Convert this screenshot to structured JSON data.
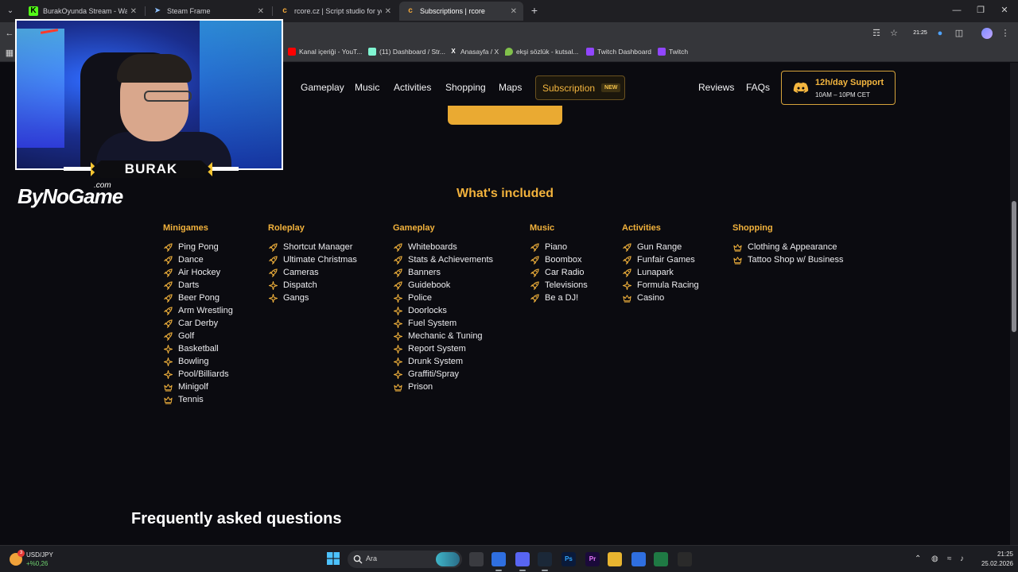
{
  "browser": {
    "tabs": [
      {
        "label": "BurakOyunda Stream - Watch L",
        "favicon": "kick-icon",
        "active": false
      },
      {
        "label": "Steam Frame",
        "favicon": "steam-icon",
        "active": false
      },
      {
        "label": "rcore.cz | Script studio for your",
        "favicon": "rcore-icon",
        "active": false
      },
      {
        "label": "Subscriptions | rcore",
        "favicon": "rcore-icon",
        "active": true
      }
    ],
    "toolbar_clock": "21:25",
    "bookmarks": [
      {
        "label": "Kanal içeriği - YouT...",
        "icon": "youtube-icon",
        "color": "#ff0000"
      },
      {
        "label": "(11) Dashboard / Str...",
        "icon": "streamlabs-icon",
        "color": "#80f5d2"
      },
      {
        "label": "Anasayfa / X",
        "icon": "x-icon",
        "color": "#ffffff"
      },
      {
        "label": "ekşi sözlük - kutsal...",
        "icon": "eksi-icon",
        "color": "#81c14b"
      },
      {
        "label": "Twitch Dashboard",
        "icon": "twitch-icon",
        "color": "#9146ff"
      },
      {
        "label": "Twitch",
        "icon": "twitch-icon",
        "color": "#9146ff"
      }
    ]
  },
  "site": {
    "nav": {
      "gameplay": "Gameplay",
      "music": "Music",
      "activities": "Activities",
      "shopping": "Shopping",
      "maps": "Maps",
      "subscription": "Subscription",
      "subscription_badge": "NEW",
      "reviews": "Reviews",
      "faqs": "FAQs"
    },
    "support": {
      "title": "12h/day Support",
      "hours": "10AM – 10PM CET",
      "icon": "discord-icon"
    },
    "included_title": "What's included",
    "columns": [
      {
        "heading": "Minigames",
        "items": [
          {
            "label": "Ping Pong",
            "icon": "rocket-icon"
          },
          {
            "label": "Dance",
            "icon": "rocket-icon"
          },
          {
            "label": "Air Hockey",
            "icon": "rocket-icon"
          },
          {
            "label": "Darts",
            "icon": "rocket-icon"
          },
          {
            "label": "Beer Pong",
            "icon": "rocket-icon"
          },
          {
            "label": "Arm Wrestling",
            "icon": "rocket-icon"
          },
          {
            "label": "Car Derby",
            "icon": "rocket-icon"
          },
          {
            "label": "Golf",
            "icon": "rocket-icon"
          },
          {
            "label": "Basketball",
            "icon": "sparkle-icon"
          },
          {
            "label": "Bowling",
            "icon": "sparkle-icon"
          },
          {
            "label": "Pool/Billiards",
            "icon": "sparkle-icon"
          },
          {
            "label": "Minigolf",
            "icon": "crown-icon"
          },
          {
            "label": "Tennis",
            "icon": "crown-icon"
          }
        ]
      },
      {
        "heading": "Roleplay",
        "items": [
          {
            "label": "Shortcut Manager",
            "icon": "rocket-icon"
          },
          {
            "label": "Ultimate Christmas",
            "icon": "rocket-icon"
          },
          {
            "label": "Cameras",
            "icon": "rocket-icon"
          },
          {
            "label": "Dispatch",
            "icon": "sparkle-icon"
          },
          {
            "label": "Gangs",
            "icon": "sparkle-icon"
          }
        ]
      },
      {
        "heading": "Gameplay",
        "items": [
          {
            "label": "Whiteboards",
            "icon": "rocket-icon"
          },
          {
            "label": "Stats & Achievements",
            "icon": "rocket-icon"
          },
          {
            "label": "Banners",
            "icon": "rocket-icon"
          },
          {
            "label": "Guidebook",
            "icon": "rocket-icon"
          },
          {
            "label": "Police",
            "icon": "sparkle-icon"
          },
          {
            "label": "Doorlocks",
            "icon": "sparkle-icon"
          },
          {
            "label": "Fuel System",
            "icon": "sparkle-icon"
          },
          {
            "label": "Mechanic & Tuning",
            "icon": "sparkle-icon"
          },
          {
            "label": "Report System",
            "icon": "sparkle-icon"
          },
          {
            "label": "Drunk System",
            "icon": "sparkle-icon"
          },
          {
            "label": "Graffiti/Spray",
            "icon": "sparkle-icon"
          },
          {
            "label": "Prison",
            "icon": "crown-icon"
          }
        ]
      },
      {
        "heading": "Music",
        "items": [
          {
            "label": "Piano",
            "icon": "rocket-icon"
          },
          {
            "label": "Boombox",
            "icon": "rocket-icon"
          },
          {
            "label": "Car Radio",
            "icon": "rocket-icon"
          },
          {
            "label": "Televisions",
            "icon": "rocket-icon"
          },
          {
            "label": "Be a DJ!",
            "icon": "rocket-icon"
          }
        ]
      },
      {
        "heading": "Activities",
        "items": [
          {
            "label": "Gun Range",
            "icon": "rocket-icon"
          },
          {
            "label": "Funfair Games",
            "icon": "rocket-icon"
          },
          {
            "label": "Lunapark",
            "icon": "rocket-icon"
          },
          {
            "label": "Formula Racing",
            "icon": "sparkle-icon"
          },
          {
            "label": "Casino",
            "icon": "crown-icon"
          }
        ]
      },
      {
        "heading": "Shopping",
        "items": [
          {
            "label": "Clothing & Appearance",
            "icon": "crown-icon"
          },
          {
            "label": "Tattoo Shop w/ Business",
            "icon": "crown-icon"
          }
        ]
      }
    ],
    "faq_title": "Frequently asked questions"
  },
  "overlay": {
    "streamer_name": "BURAK",
    "logo": "ByNoGame",
    "logo_suffix": ".com"
  },
  "taskbar": {
    "ticker_name": "USD/JPY",
    "ticker_value": "+%0,26",
    "ticker_badge": "3",
    "search_placeholder": "Ara",
    "apps": [
      {
        "name": "files-icon",
        "label": ""
      },
      {
        "name": "chrome-icon",
        "label": ""
      },
      {
        "name": "discord-icon",
        "label": ""
      },
      {
        "name": "steam-icon",
        "label": ""
      },
      {
        "name": "photoshop-icon",
        "label": "Ps"
      },
      {
        "name": "premiere-icon",
        "label": "Pr"
      },
      {
        "name": "explorer-icon",
        "label": ""
      },
      {
        "name": "app-icon",
        "label": ""
      },
      {
        "name": "excel-icon",
        "label": ""
      },
      {
        "name": "obs-icon",
        "label": ""
      }
    ],
    "time": "21:25",
    "date": "25.02.2026"
  }
}
